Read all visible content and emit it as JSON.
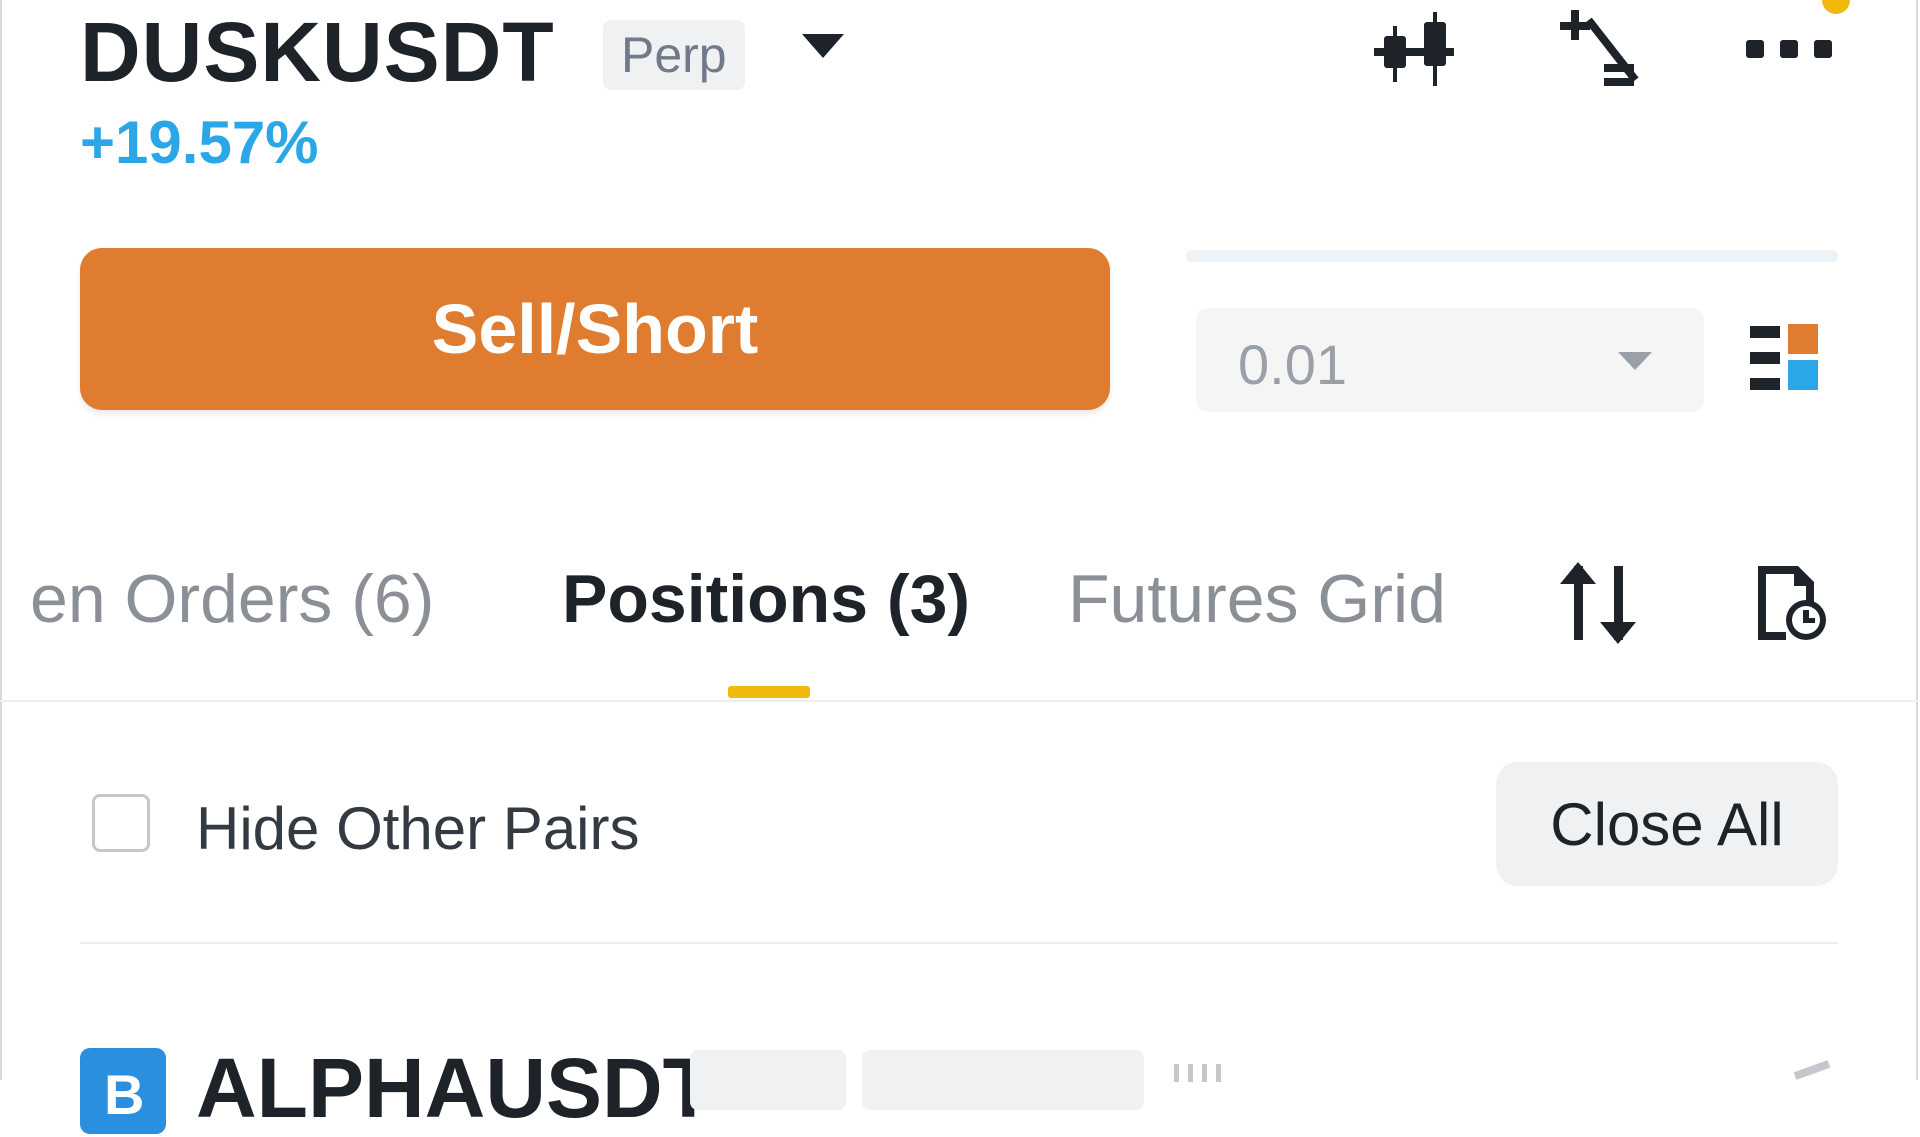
{
  "header": {
    "symbol": "DUSKUSDT",
    "contract_type": "Perp",
    "change_percent": "+19.57%",
    "change_color": "#2ba7e8",
    "icons": [
      "candlestick-chart-icon",
      "percent-calculator-icon",
      "more-options-icon"
    ],
    "notification_dot_color": "#f0b90b"
  },
  "trade": {
    "sell_label": "Sell/Short",
    "sell_color": "#e07c30",
    "quantity_step": "0.01",
    "layout_icon": "orderbook-layout-icon"
  },
  "tabs": {
    "items": [
      {
        "label": "en Orders (6)",
        "active": false
      },
      {
        "label": "Positions (3)",
        "active": true
      },
      {
        "label": "Futures Grid",
        "active": false
      }
    ],
    "accent_color": "#f0b90b",
    "icons": [
      "sort-arrows-icon",
      "history-icon"
    ]
  },
  "filters": {
    "hide_other_pairs_label": "Hide Other Pairs",
    "hide_other_pairs_checked": false,
    "close_all_label": "Close All"
  },
  "positions": [
    {
      "badge": "B",
      "symbol": "ALPHAUSDT"
    }
  ]
}
